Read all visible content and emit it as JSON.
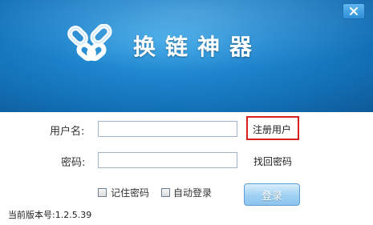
{
  "app": {
    "title": "换链神器"
  },
  "window": {
    "close_icon": "close-icon"
  },
  "form": {
    "username_label": "用户名:",
    "password_label": "密码:",
    "username_value": "",
    "password_value": "",
    "register_link": "注册用户",
    "recover_link": "找回密码",
    "remember_label": "记住密码",
    "autologin_label": "自动登录",
    "login_button": "登录"
  },
  "footer": {
    "version": "当前版本号:1.2.5.39"
  },
  "colors": {
    "banner": "#1f86cf",
    "highlight": "#d81e1e",
    "button": "#9fd0f3"
  }
}
